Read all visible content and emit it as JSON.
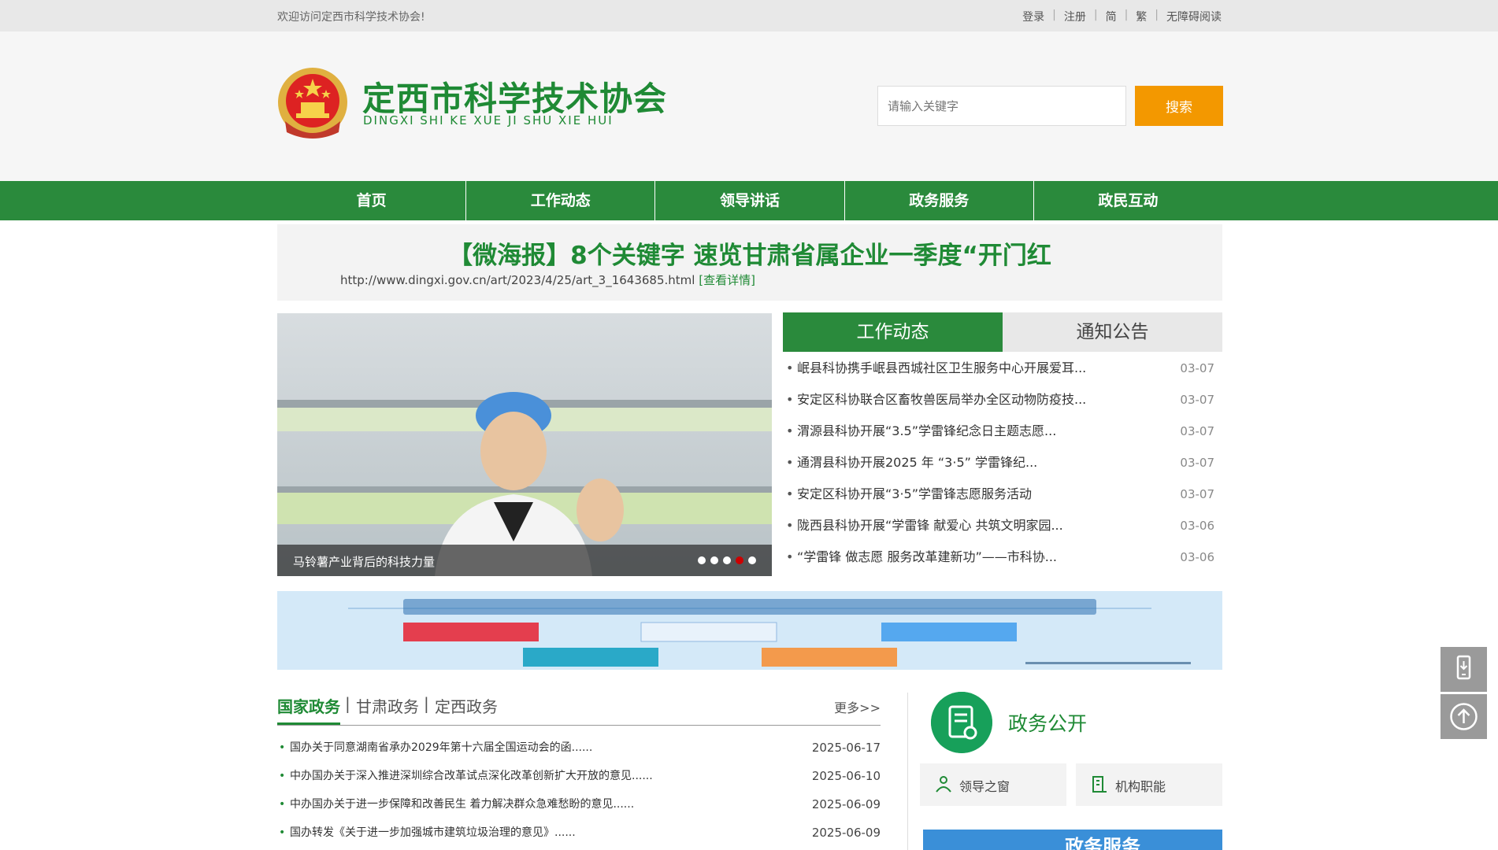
{
  "topbar": {
    "welcome": "欢迎访问定西市科学技术协会!",
    "links": [
      "登录",
      "注册",
      "简",
      "繁",
      "无障碍阅读"
    ]
  },
  "header": {
    "title": "定西市科学技术协会",
    "subtitle": "DINGXI SHI KE XUE JI SHU XIE HUI",
    "search_placeholder": "请输入关键字",
    "search_button": "搜索"
  },
  "nav": [
    "首页",
    "工作动态",
    "领导讲话",
    "政务服务",
    "政民互动"
  ],
  "headline": {
    "title": "【微海报】8个关键字 速览甘肃省属企业一季度“开门红",
    "url": "http://www.dingxi.gov.cn/art/2023/4/25/art_3_1643685.html",
    "detail_link": "[查看详情]"
  },
  "slider": {
    "caption": "马铃薯产业背后的科技力量",
    "dot_count": 5,
    "active_dot": 3
  },
  "news_tabs": {
    "active": "工作动态",
    "inactive": "通知公告"
  },
  "news": [
    {
      "title": "岷县科协携手岷县西城社区卫生服务中心开展爱耳...",
      "date": "03-07"
    },
    {
      "title": "安定区科协联合区畜牧兽医局举办全区动物防疫技...",
      "date": "03-07"
    },
    {
      "title": "渭源县科协开展“3.5”学雷锋纪念日主题志愿...",
      "date": "03-07"
    },
    {
      "title": "通渭县科协开展2025 年 “3·5” 学雷锋纪...",
      "date": "03-07"
    },
    {
      "title": "安定区科协开展“3·5”学雷锋志愿服务活动",
      "date": "03-07"
    },
    {
      "title": "陇西县科协开展“学雷锋 献爱心 共筑文明家园...",
      "date": "03-06"
    },
    {
      "title": "“学雷锋 做志愿 服务改革建新功”——市科协...",
      "date": "03-06"
    }
  ],
  "gov_tabs": {
    "active": "国家政务",
    "inactive": [
      "甘肃政务",
      "定西政务"
    ],
    "more": "更多>>"
  },
  "gov_news": [
    {
      "title": "国办关于同意湖南省承办2029年第十六届全国运动会的函......",
      "date": "2025-06-17"
    },
    {
      "title": "中办国办关于深入推进深圳综合改革试点深化改革创新扩大开放的意见......",
      "date": "2025-06-10"
    },
    {
      "title": "中办国办关于进一步保障和改善民生 着力解决群众急难愁盼的意见......",
      "date": "2025-06-09"
    },
    {
      "title": "国办转发《关于进一步加强城市建筑垃圾治理的意见》......",
      "date": "2025-06-09"
    }
  ],
  "gov_open": {
    "title": "政务公开",
    "links": [
      "领导之窗",
      "机构职能"
    ]
  },
  "bottom_banner": "政务服务",
  "colors": {
    "brand_green": "#2a8a3c",
    "search_orange": "#f39800",
    "tab_inactive": "#e8e8e8"
  }
}
